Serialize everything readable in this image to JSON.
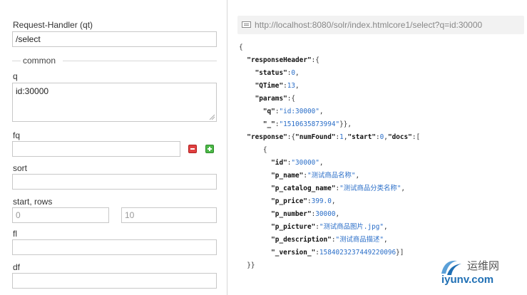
{
  "form": {
    "handler_label": "Request-Handler (qt)",
    "handler_value": "/select",
    "common_legend": "common",
    "q_label": "q",
    "q_value": "id:30000",
    "fq_label": "fq",
    "fq_value": "",
    "sort_label": "sort",
    "sort_value": "",
    "start_rows_label": "start, rows",
    "start_placeholder": "0",
    "rows_placeholder": "10",
    "fl_label": "fl",
    "fl_value": "",
    "df_label": "df",
    "df_value": ""
  },
  "result": {
    "url": "http://localhost:8080/solr/index.htmlcore1/select?q=id:30000",
    "json": {
      "responseHeader_key": "\"responseHeader\"",
      "status_key": "\"status\"",
      "status_val": "0",
      "qtime_key": "\"QTime\"",
      "qtime_val": "13",
      "params_key": "\"params\"",
      "q_key": "\"q\"",
      "q_val": "\"id:30000\"",
      "underscore_key": "\"_\"",
      "underscore_val": "\"1510635873994\"",
      "response_key": "\"response\"",
      "numFound_key": "\"numFound\"",
      "numFound_val": "1",
      "start_key": "\"start\"",
      "start_val": "0",
      "docs_key": "\"docs\"",
      "id_key": "\"id\"",
      "id_val": "\"30000\"",
      "p_name_key": "\"p_name\"",
      "p_name_val": "\"测试商品名称\"",
      "p_catalog_key": "\"p_catalog_name\"",
      "p_catalog_val": "\"测试商品分类名称\"",
      "p_price_key": "\"p_price\"",
      "p_price_val": "399.0",
      "p_number_key": "\"p_number\"",
      "p_number_val": "30000",
      "p_picture_key": "\"p_picture\"",
      "p_picture_val": "\"测试商品图片.jpg\"",
      "p_desc_key": "\"p_description\"",
      "p_desc_val": "\"测试商品描述\"",
      "version_key": "\"_version_\"",
      "version_val": "1584023237449220096"
    }
  },
  "watermark": {
    "top": "运维网",
    "bottom": "iyunv.com"
  }
}
